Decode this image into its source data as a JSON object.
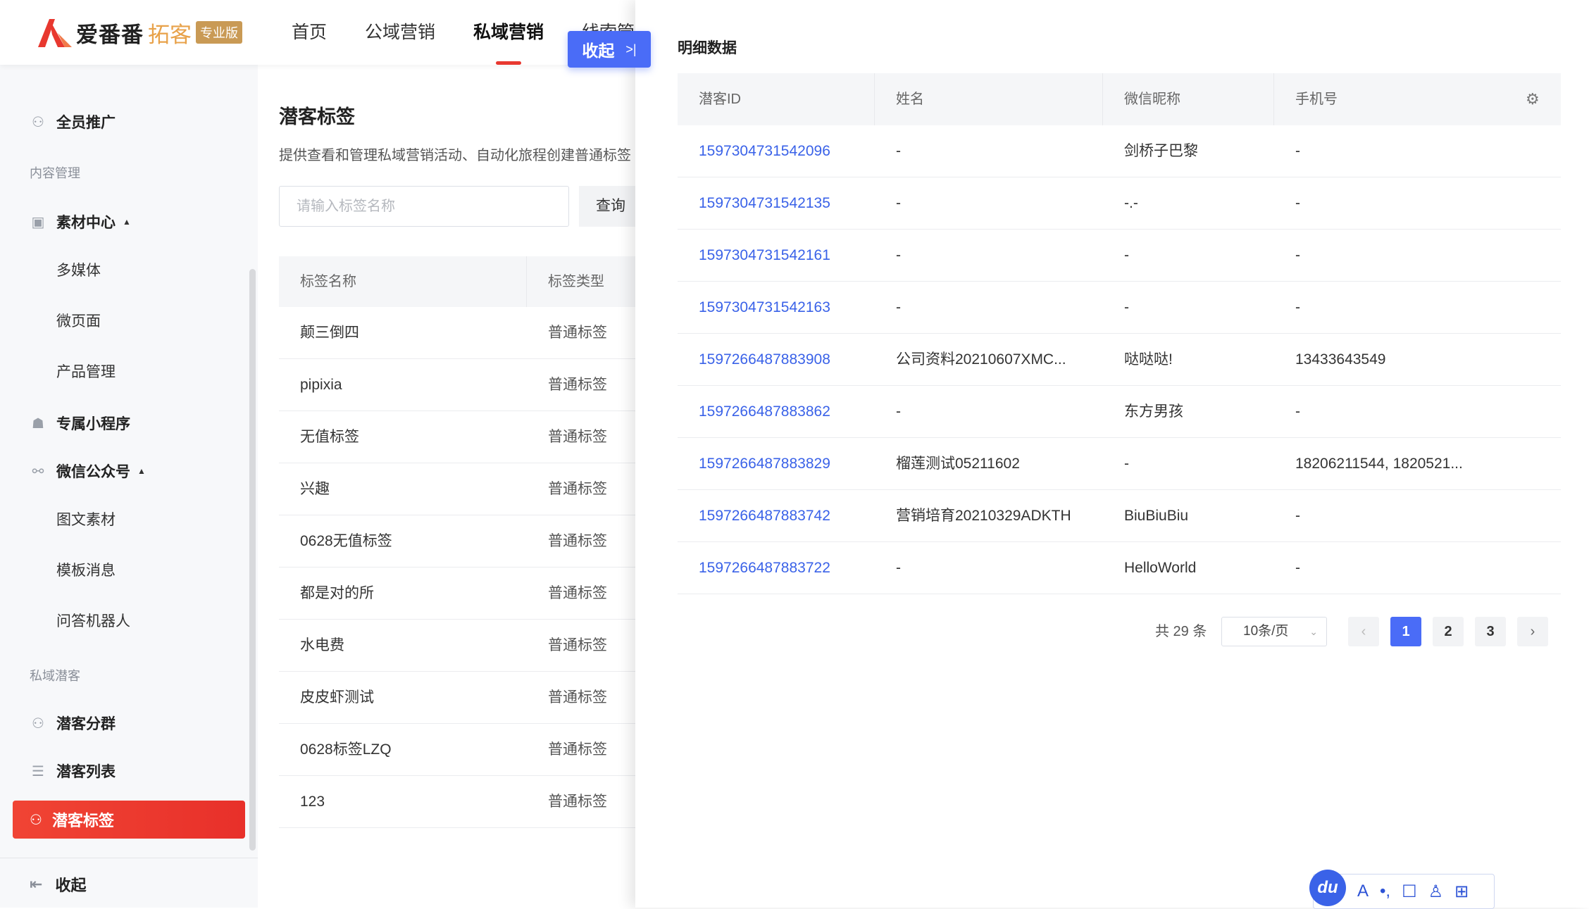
{
  "brand": {
    "name": "爱番番",
    "product": "拓客",
    "edition": "专业版"
  },
  "nav": {
    "items": [
      "首页",
      "公域营销",
      "私域营销",
      "线索管"
    ],
    "active_index": 2
  },
  "collapse_button": {
    "label": "收起",
    "chevron": ">|"
  },
  "sidebar": {
    "top_item": "全员推广",
    "group_content": "内容管理",
    "material_center": "素材中心",
    "material_subs": [
      "多媒体",
      "微页面",
      "产品管理"
    ],
    "mini_program": "专属小程序",
    "wechat_oa": "微信公众号",
    "wechat_subs": [
      "图文素材",
      "模板消息",
      "问答机器人"
    ],
    "group_private": "私域潜客",
    "segment": "潜客分群",
    "list": "潜客列表",
    "active": "潜客标签",
    "footer": "收起"
  },
  "page": {
    "title": "潜客标签",
    "desc": "提供查看和管理私域营销活动、自动化旅程创建普通标签",
    "search_placeholder": "请输入标签名称",
    "query_label": "查询"
  },
  "tag_table": {
    "headers": [
      "标签名称",
      "标签类型"
    ],
    "rows": [
      [
        "颠三倒四",
        "普通标签"
      ],
      [
        "pipixia",
        "普通标签"
      ],
      [
        "无值标签",
        "普通标签"
      ],
      [
        "兴趣",
        "普通标签"
      ],
      [
        "0628无值标签",
        "普通标签"
      ],
      [
        "都是对的所",
        "普通标签"
      ],
      [
        "水电费",
        "普通标签"
      ],
      [
        "皮皮虾测试",
        "普通标签"
      ],
      [
        "0628标签LZQ",
        "普通标签"
      ],
      [
        "123",
        "普通标签"
      ]
    ]
  },
  "drawer": {
    "title": "明细数据",
    "headers": [
      "潜客ID",
      "姓名",
      "微信昵称",
      "手机号"
    ],
    "rows": [
      [
        "1597304731542096",
        "-",
        "剑桥子巴黎",
        "-"
      ],
      [
        "1597304731542135",
        "-",
        "-.-",
        "-"
      ],
      [
        "1597304731542161",
        "-",
        "-",
        "-"
      ],
      [
        "1597304731542163",
        "-",
        "-",
        "-"
      ],
      [
        "1597266487883908",
        "公司资料20210607XMC...",
        "哒哒哒!",
        "13433643549"
      ],
      [
        "1597266487883862",
        "-",
        "东方男孩",
        "-"
      ],
      [
        "1597266487883829",
        "榴莲测试05211602",
        "-",
        "18206211544, 1820521..."
      ],
      [
        "1597266487883742",
        "营销培育20210329ADKTH",
        "BiuBiuBiu",
        "-"
      ],
      [
        "1597266487883722",
        "-",
        "HelloWorld",
        "-"
      ]
    ],
    "pagination": {
      "total": "共 29 条",
      "page_size": "10条/页",
      "pages": [
        "1",
        "2",
        "3"
      ],
      "current": 1
    }
  },
  "ime": {
    "logo": "du",
    "icons": [
      "A",
      "•,",
      "☐",
      "♙",
      "⊞"
    ]
  },
  "colors": {
    "accent": "#4a6cf7",
    "active_red": "#e8302a",
    "link": "#3a62e8"
  }
}
